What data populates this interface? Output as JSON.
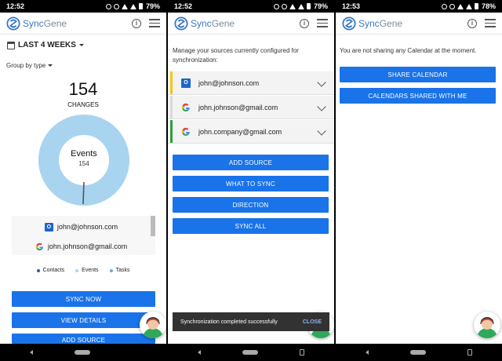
{
  "status_bars": [
    {
      "time": "12:52",
      "battery": "79%"
    },
    {
      "time": "12:52",
      "battery": "79%"
    },
    {
      "time": "12:53",
      "battery": "78%"
    }
  ],
  "app": {
    "logo_sync": "Sync",
    "logo_gene": "Gene",
    "info_icon": "info-icon",
    "menu_icon": "hamburger-menu-icon"
  },
  "dashboard": {
    "range_label": "LAST 4 WEEKS",
    "group_by": "Group by type",
    "total_changes": "154",
    "changes_label": "CHANGES",
    "donut_center_label": "Events",
    "donut_center_value": "154",
    "accounts": [
      {
        "email": "john@johnson.com",
        "icon": "outlook-icon"
      },
      {
        "email": "john.johnson@gmail.com",
        "icon": "google-icon"
      }
    ],
    "legend": [
      {
        "label": "Contacts",
        "color": "#1a5fd0"
      },
      {
        "label": "Events",
        "color": "#a8d4f0"
      },
      {
        "label": "Tasks",
        "color": "#6fa8dc"
      }
    ],
    "buttons": [
      "SYNC NOW",
      "VIEW DETAILS",
      "ADD SOURCE"
    ]
  },
  "sources": {
    "intro": "Manage your sources currently configured for synchronization:",
    "items": [
      {
        "email": "john@johnson.com",
        "icon": "outlook-icon",
        "color": "#f5c518"
      },
      {
        "email": "john.johnson@gmail.com",
        "icon": "google-icon",
        "color": "#d9d9d9"
      },
      {
        "email": "john.company@gmail.com",
        "icon": "google-icon",
        "color": "#2e9e3e"
      }
    ],
    "buttons": [
      "ADD SOURCE",
      "WHAT TO SYNC",
      "DIRECTION",
      "SYNC ALL"
    ],
    "snackbar_text": "Synchronization completed successfully",
    "snackbar_action": "CLOSE"
  },
  "calendar_share": {
    "message": "You are not sharing any Calendar at the moment.",
    "buttons": [
      "SHARE CALENDAR",
      "CALENDARS SHARED WITH ME"
    ]
  },
  "colors": {
    "primary": "#1a73e8",
    "donut": "#a8d4f0"
  }
}
